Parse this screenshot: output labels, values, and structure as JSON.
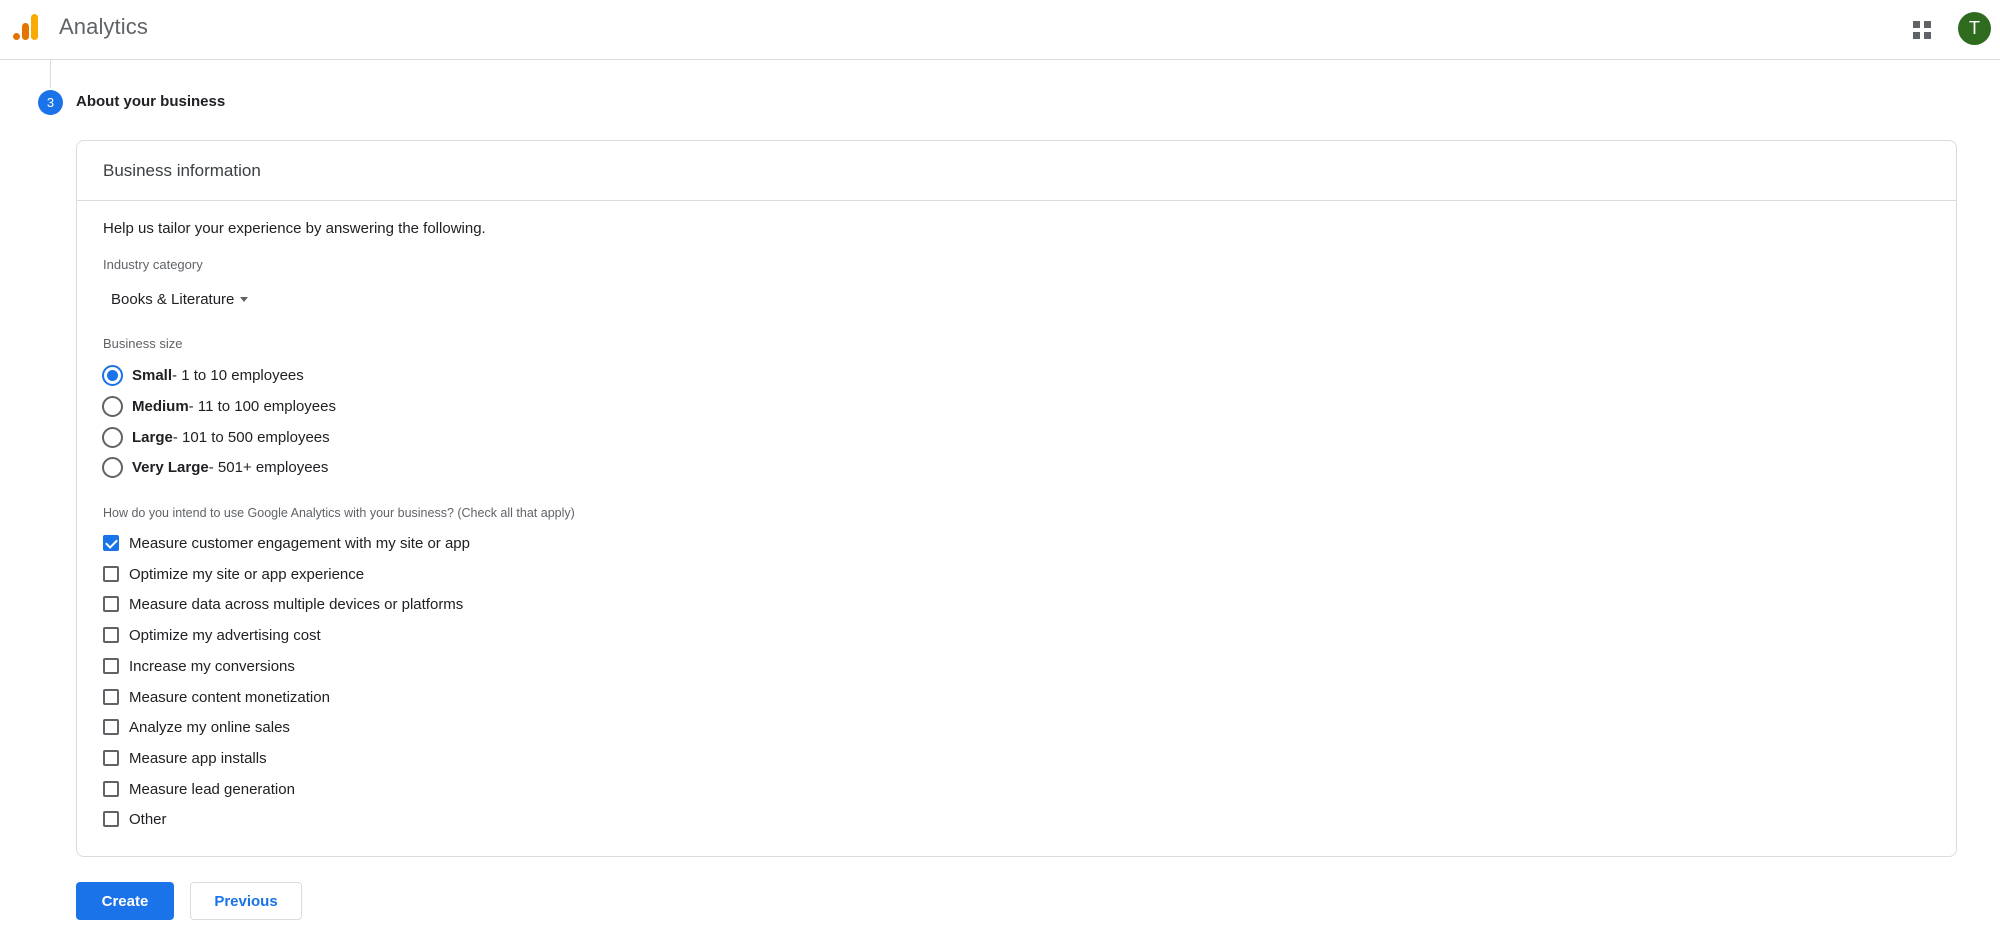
{
  "header": {
    "app_title": "Analytics",
    "avatar_letter": "T",
    "logo_icon": "analytics-bars-icon",
    "apps_icon": "apps-grid-icon"
  },
  "step": {
    "number": "3",
    "title": "About your business"
  },
  "card": {
    "title": "Business information",
    "intro": "Help us tailor your experience by answering the following.",
    "industry": {
      "label": "Industry category",
      "value": "Books & Literature"
    },
    "business_size": {
      "label": "Business size",
      "options": [
        {
          "name": "Small",
          "detail": " - 1 to 10 employees",
          "selected": true
        },
        {
          "name": "Medium",
          "detail": " - 11 to 100 employees",
          "selected": false
        },
        {
          "name": "Large",
          "detail": " - 101 to 500 employees",
          "selected": false
        },
        {
          "name": "Very Large",
          "detail": " - 501+ employees",
          "selected": false
        }
      ]
    },
    "usage": {
      "label": "How do you intend to use Google Analytics with your business? (Check all that apply)",
      "options": [
        {
          "label": "Measure customer engagement with my site or app",
          "checked": true
        },
        {
          "label": "Optimize my site or app experience",
          "checked": false
        },
        {
          "label": "Measure data across multiple devices or platforms",
          "checked": false
        },
        {
          "label": "Optimize my advertising cost",
          "checked": false
        },
        {
          "label": "Increase my conversions",
          "checked": false
        },
        {
          "label": "Measure content monetization",
          "checked": false
        },
        {
          "label": "Analyze my online sales",
          "checked": false
        },
        {
          "label": "Measure app installs",
          "checked": false
        },
        {
          "label": "Measure lead generation",
          "checked": false
        },
        {
          "label": "Other",
          "checked": false
        }
      ]
    }
  },
  "actions": {
    "create_label": "Create",
    "previous_label": "Previous"
  },
  "colors": {
    "accent": "#1a73e8",
    "avatar": "#2e6b1f",
    "logo_orange": "#f9ab00",
    "logo_dark": "#e37400"
  }
}
